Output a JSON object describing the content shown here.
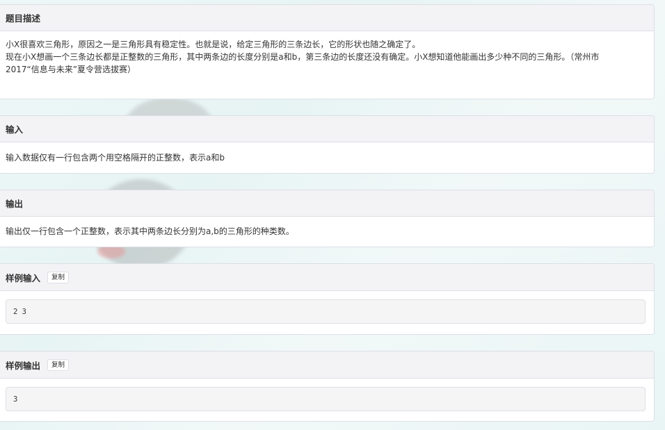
{
  "description": {
    "title": "题目描述",
    "lines": [
      "小X很喜欢三角形，原因之一是三角形具有稳定性。也就是说，给定三角形的三条边长，它的形状也随之确定了。",
      "现在小X想画一个三条边长都是正整数的三角形，其中两条边的长度分别是a和b，第三条边的长度还没有确定。小X想知道他能画出多少种不同的三角形。（常州市",
      "2017“信息与未来”夏令营选拔赛）"
    ]
  },
  "input": {
    "title": "输入",
    "text": "输入数据仅有一行包含两个用空格隔开的正整数，表示a和b"
  },
  "output": {
    "title": "输出",
    "text": "输出仅一行包含一个正整数，表示其中两条边长分别为a,b的三角形的种类数。"
  },
  "sample_input": {
    "title": "样例输入",
    "copy_label": "复制",
    "value": "2 3"
  },
  "sample_output": {
    "title": "样例输出",
    "copy_label": "复制",
    "value": "3"
  }
}
